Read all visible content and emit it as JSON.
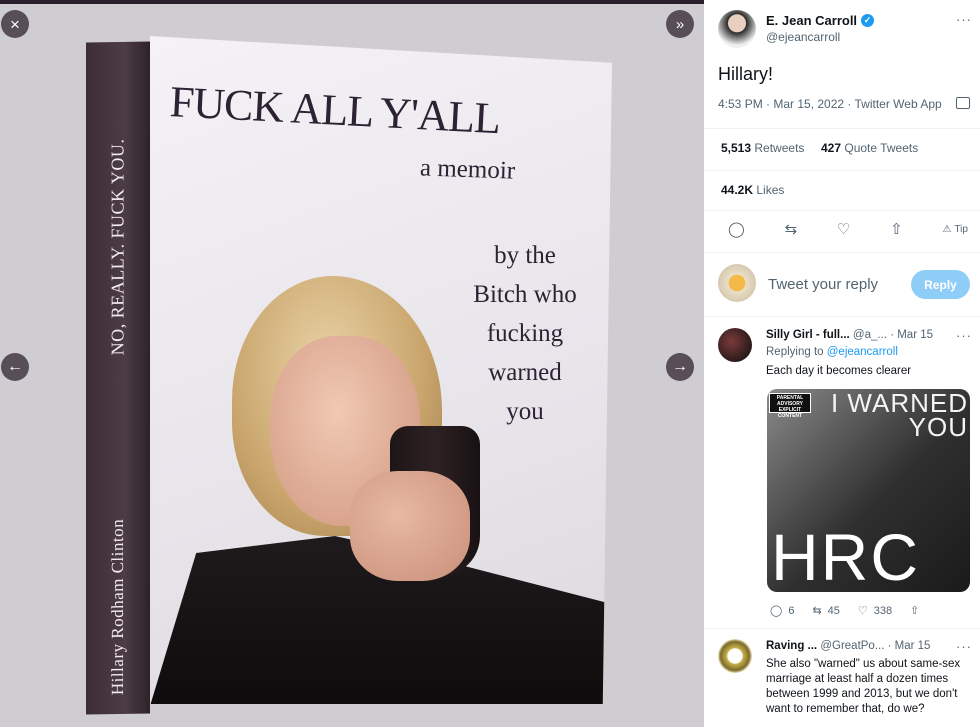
{
  "viewer": {
    "close_icon": "×",
    "expand_icon": "»",
    "prev_icon": "←",
    "next_icon": "→",
    "book": {
      "spine_top": "NO, REALLY. FUCK YOU.",
      "spine_bottom": "Hillary Rodham Clinton",
      "title": "FUCK ALL Y'ALL",
      "subtitle": "a memoir",
      "byline_lines": [
        "by the",
        "Bitch who",
        "fucking",
        "warned",
        "you"
      ]
    }
  },
  "tweet": {
    "author_name": "E. Jean Carroll",
    "verified_icon": "✓",
    "author_handle": "@ejeancarroll",
    "more_icon": "···",
    "text": "Hillary!",
    "meta": "4:53 PM · Mar 15, 2022 · Twitter Web App",
    "retweets_count": "5,513",
    "retweets_label": "Retweets",
    "quotes_count": "427",
    "quotes_label": "Quote Tweets",
    "likes_count": "44.2K",
    "likes_label": "Likes",
    "actions": {
      "reply_icon": "◯",
      "retweet_icon": "⇆",
      "like_icon": "♡",
      "share_icon": "⇧",
      "tip_icon": "⚠",
      "tip_label": "Tip"
    }
  },
  "compose": {
    "placeholder": "Tweet your reply",
    "button": "Reply"
  },
  "replies": [
    {
      "name": "Silly Girl - full...",
      "handle": "@a_...",
      "date": "· Mar 15",
      "replying_prefix": "Replying to",
      "replying_to": "@ejeancarroll",
      "text": "Each day it becomes clearer",
      "media": {
        "advisory": "PARENTAL ADVISORY EXPLICIT CONTENT",
        "warned": "I WARNED YOU",
        "hrc": "HRC"
      },
      "stats": {
        "replies": "6",
        "retweets": "45",
        "likes": "338"
      }
    },
    {
      "name": "Raving ...",
      "handle": "@GreatPo...",
      "date": "· Mar 15",
      "text": "She also \"warned\" us about same-sex marriage at least half a dozen times between 1999 and 2013, but we don't want to remember that, do we?"
    }
  ]
}
